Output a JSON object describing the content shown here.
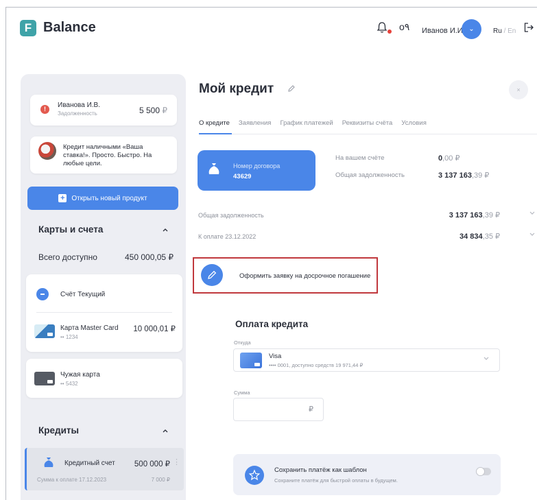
{
  "header": {
    "logo_letter": "F",
    "app_name": "Balance",
    "key_glyph": "о٩",
    "user_name": "Иванов И.И.",
    "avatar_chevron": "⌄",
    "lang_active": "Ru",
    "lang_sep": "/",
    "lang_inactive": "En"
  },
  "sidebar": {
    "debt": {
      "badge": "!",
      "name": "Иванова И.В.",
      "label": "Задолженность",
      "amount": "5 500",
      "currency": "₽"
    },
    "promo": {
      "text": "Кредит наличными «Ваша ставка!». Просто. Быстро. На любые цели."
    },
    "open_product_label": "Открыть новый продукт",
    "open_product_plus": "+",
    "accounts_section": {
      "title": "Карты и счета",
      "total_label": "Всего доступно",
      "total_value": "450 000,05 ₽",
      "current_account": "Счёт Текущий",
      "master_card": {
        "name": "Карта Master Card",
        "number": "•• 1234",
        "value": "10 000,01 ₽"
      },
      "foreign_card": {
        "name": "Чужая карта",
        "number": "•• 5432"
      }
    },
    "credits_section": {
      "title": "Кредиты",
      "account": {
        "name": "Кредитный счет",
        "value": "500 000 ₽",
        "due_label": "Сумма к оплате 17.12.2023",
        "due_value": "7 000 ₽"
      }
    }
  },
  "main": {
    "title": "Мой кредит",
    "close": "×",
    "tabs": [
      {
        "label": "О кредите",
        "active": true
      },
      {
        "label": "Заявления",
        "active": false
      },
      {
        "label": "График платежей",
        "active": false
      },
      {
        "label": "Реквизиты счёта",
        "active": false
      },
      {
        "label": "Условия",
        "active": false
      }
    ],
    "contract": {
      "label": "Номер договора",
      "number": "43629"
    },
    "on_account_label": "На вашем счёте",
    "on_account_int": "0",
    "on_account_kop": ",00 ₽",
    "total_debt_label": "Общая задолженность",
    "total_debt_int": "3 137 163",
    "total_debt_kop": ",39 ₽",
    "summary_rows": [
      {
        "label": "Общая задолженность",
        "int": "3 137 163",
        "kop": ",39 ₽"
      },
      {
        "label": "К оплате 23.12.2022",
        "int": "34 834",
        "kop": ",35 ₽"
      }
    ],
    "early_repayment_label": "Оформить заявку на досрочное погашение",
    "payment": {
      "title": "Оплата кредита",
      "from_label": "Откуда",
      "card_name": "Visa",
      "card_sub": "•••• 0001, доступно средств 19 971,44 ₽",
      "sum_label": "Сумма",
      "sum_currency": "₽"
    },
    "template": {
      "title": "Сохранить платёж как шаблон",
      "subtitle": "Сохраните платёж для быстрой оплаты в будущем.",
      "toggle_on": false
    }
  },
  "colors": {
    "accent": "#4a86e8",
    "logo": "#3fa3a8",
    "highlight_border": "#c0383d",
    "debt_dot": "#e35a4f"
  }
}
